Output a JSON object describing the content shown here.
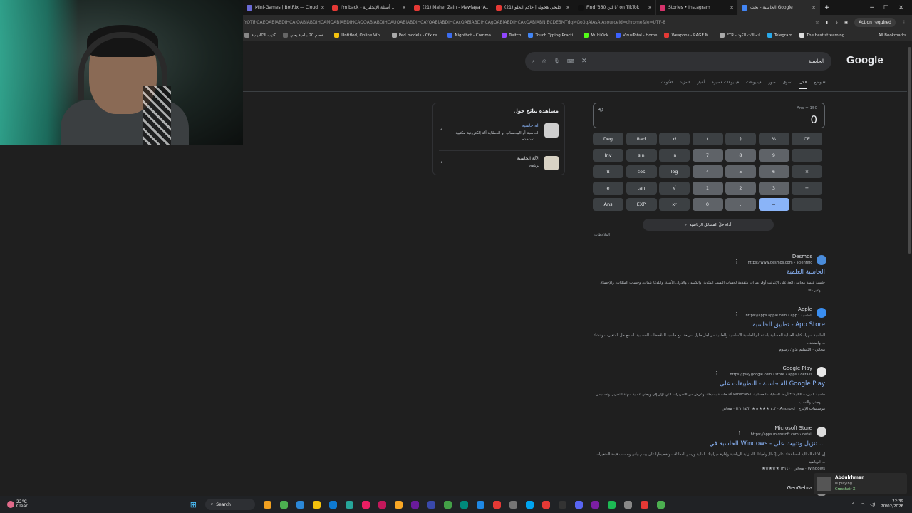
{
  "browser": {
    "tabs": [
      {
        "label": "Mini-Games | BotRix — Cloud",
        "color": "#6b6bd6"
      },
      {
        "label": "I'm back - أسئلة الإنجليزية ...",
        "color": "#e53935"
      },
      {
        "label": "(21) Maher Zain - Mawlaya (A...",
        "color": "#e53935"
      },
      {
        "label": "(21) خليجي هجوله | جاكم الحلو",
        "color": "#e53935"
      },
      {
        "label": "Find '360 يا لتن' on TikTok",
        "color": "#111111"
      },
      {
        "label": "Stories • Instagram",
        "color": "#d6336c"
      },
      {
        "label": "الحاسبة - بحث Google",
        "color": "#4285f4"
      }
    ],
    "new_tab": "+",
    "url": "YOTIhCAEQABiABDIHCAIQABiABDIHCAMQABiABDIHCAQQABiABDIHCAUQABiABDIHCAYQABiABDIHCAcQABiABDIHCAgQABiABDIHCAkQABiABNIBCDE5MTdqMGo3qAIAsAIAsourceid=chrome&ie=UTF-8",
    "action_required": "Action required",
    "bookmarks": [
      {
        "label": "كتيب الاكاديمية",
        "color": "#888"
      },
      {
        "label": "خصم 20 بالمية يعني...",
        "color": "#666"
      },
      {
        "label": "Untitled, Online Whi...",
        "color": "#f4c20d"
      },
      {
        "label": "Ped models - Cfx.re...",
        "color": "#aaa"
      },
      {
        "label": "Nightbot - Comma...",
        "color": "#3c6df0"
      },
      {
        "label": "Twitch",
        "color": "#9146ff"
      },
      {
        "label": "Touch Typing Practi...",
        "color": "#4285f4"
      },
      {
        "label": "MultiKick",
        "color": "#53fc18"
      },
      {
        "label": "VirusTotal - Home",
        "color": "#3b61ff"
      },
      {
        "label": "Weapons - RAGE M...",
        "color": "#e53935"
      },
      {
        "label": "FTR - اتصالات الكود",
        "color": "#aaa"
      },
      {
        "label": "Telegram",
        "color": "#29a9eb"
      },
      {
        "label": "The best streaming...",
        "color": "#ddd"
      }
    ],
    "all_bookmarks": "All Bookmarks"
  },
  "google": {
    "logo": "Google",
    "query": "الحاسبة",
    "nav_tabs": [
      "وضع AI",
      "الكل",
      "تسوق",
      "صور",
      "فيديوهات",
      "فيديوهات قصيرة",
      "أخبار",
      "المزيد",
      "الأدوات"
    ],
    "active_tab": "الكل"
  },
  "calculator": {
    "history": "Ans = 150",
    "result": "0",
    "keys": [
      [
        "Deg",
        "Rad",
        "x!",
        "(",
        ")",
        "%",
        "CE"
      ],
      [
        "Inv",
        "sin",
        "ln",
        "7",
        "8",
        "9",
        "÷"
      ],
      [
        "π",
        "cos",
        "log",
        "4",
        "5",
        "6",
        "×"
      ],
      [
        "e",
        "tan",
        "√",
        "1",
        "2",
        "3",
        "−"
      ],
      [
        "Ans",
        "EXP",
        "xʸ",
        "0",
        ".",
        "=",
        "+"
      ]
    ],
    "math_solver": "أداة حلّ المسائل الرياضية",
    "notes": "الملاحظات"
  },
  "side_panel": {
    "title": "مشاهدة نتائج حول",
    "items": [
      {
        "title": "آلة حاسبة",
        "desc": "الحاسبة أو المِحساب أو الحسّابة آلة إلكترونية مكتبية تستخدم ..."
      },
      {
        "title": "الآلة الحاسبة",
        "desc": "برنامج"
      }
    ]
  },
  "results": [
    {
      "site": "Desmos",
      "url": "https://www.desmos.com › scientific",
      "title": "الحاسبة العلمية",
      "snippet": "حاسبة علمية مجانية رائعة على الإنترنت أوفر ميزات متقدمة لحساب النسب المئوية، والكسور، والدوال الأسية، واللوغاريتمات، وحساب المثلثات، والإحصاء، وغير ذلك ...",
      "icon_color": "#4a8cdb",
      "meta": ""
    },
    {
      "site": "Apple",
      "url": "https://apps.apple.com › app › الحاسبة",
      "title": "تطبيق الحاسبة - App Store",
      "snippet": "الحاسبة سهولة كتابة العملية الحسابية باستخدام الحاسبة الأساسية والعلمية من أجل حلول سريعة. مع حاسبة الملاحظات الحسابية، اسمح حل المتغيرات وإنشاء واستخدام ...",
      "icon_color": "#3a8ef0",
      "meta": "مجاني · التسليم بدون رسوم"
    },
    {
      "site": "Google Play",
      "url": "https://play.google.com › store › apps › details",
      "title": "آلة حاسبة - التطبيقات على Google Play",
      "snippet": "آلة حاسبة بسيطة، وعرض من التحريرات التي تؤثر إلى ويحتي عملية سهلة التحرير. وتصميمن PanecalST حاسبة الميزات التالية: * أربعة العمليات الحسابية، وجذر، والنسب ...",
      "icon_color": "#e8e8e8",
      "meta": "٤.٣ ★★★★★ (٢١,١٤٦) · مجاني · Android · مؤسسات الإنتاج"
    },
    {
      "site": "Microsoft Store",
      "url": "https://apps.microsoft.com › detail",
      "title": "الحاسبة في Windows - تنزيل وتثبيت على ...",
      "snippet": "إن الأداة المثالية لمساعدتك على إكمال واجباتك المنزلية الرياضية وإدارة ميزانيتك المالية ورسم المعادلات وتخطيطها على رسم بياني وحساب قيمة المتغيرات الرياضية ...",
      "icon_color": "#dcdcdc",
      "meta": "★★★★★ (٢١٤) · مجاني · Windows"
    },
    {
      "site": "GeoGebra",
      "url": "",
      "title": "",
      "snippet": "",
      "icon_color": "#888",
      "meta": ""
    }
  ],
  "notification": {
    "name": "Abdulrhman",
    "status": "is playing",
    "game": "Crosshair X"
  },
  "taskbar": {
    "temp": "22°C",
    "weather": "Clear",
    "search": "Search",
    "time": "22:39",
    "date": "20/02/2026",
    "icon_colors": [
      "#f0a020",
      "#4caf50",
      "#2b88d8",
      "#f4c20d",
      "#0e7ad1",
      "#26a69a",
      "#e91e63",
      "#c2185b",
      "#f9a825",
      "#6a1b9a",
      "#3949ab",
      "#43a047",
      "#00897b",
      "#1e88e5",
      "#e53935",
      "#757575",
      "#00a4ef",
      "#e53935",
      "#333333",
      "#5865f2",
      "#7b1fa2",
      "#1db954",
      "#888888",
      "#e53935",
      "#4caf50"
    ]
  }
}
